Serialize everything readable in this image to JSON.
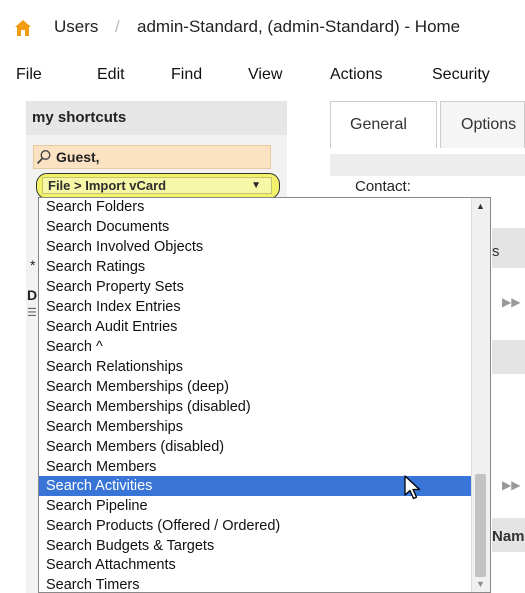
{
  "breadcrumb": {
    "users": "Users",
    "separator": "/",
    "current": "admin-Standard, (admin-Standard) - Home"
  },
  "menubar": {
    "items": [
      "File",
      "Edit",
      "Find",
      "View",
      "Actions",
      "Security"
    ]
  },
  "sidebar": {
    "title": "my shortcuts",
    "search_value": "Guest,",
    "shortcut_selected": "File > Import vCard",
    "frag_star": "*",
    "frag_d": "D",
    "frag_list": "☰"
  },
  "tabs": {
    "general": "General",
    "options": "Options"
  },
  "main": {
    "contact_label": "Contact:",
    "frag_s": "s",
    "frag_nam": "Nam"
  },
  "dropdown": {
    "items": [
      "Search Folders",
      "Search Documents",
      "Search Involved Objects",
      "Search Ratings",
      "Search Property Sets",
      "Search Index Entries",
      "Search Audit Entries",
      "Search ^",
      "Search Relationships",
      "Search Memberships (deep)",
      "Search Memberships (disabled)",
      "Search Memberships",
      "Search Members (disabled)",
      "Search Members",
      "Search Activities",
      "Search Pipeline",
      "Search Products (Offered / Ordered)",
      "Search Budgets & Targets",
      "Search Attachments",
      "Search Timers"
    ],
    "selected_index": 14
  },
  "colors": {
    "accent": "#3875d7",
    "search_bg": "#fbe2c2",
    "shortcut_bg": "#f4f26a",
    "home_icon": "#f39c12"
  }
}
